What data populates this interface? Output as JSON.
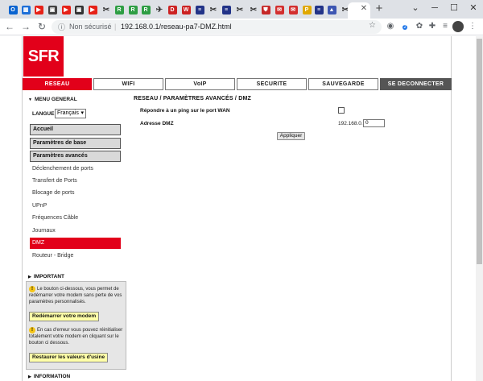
{
  "browser": {
    "tabs": [
      {
        "icon": "outlook",
        "color": "#0a64d0",
        "glyph": "O"
      },
      {
        "icon": "tab-generic",
        "color": "#1d6fd8",
        "glyph": "▦"
      },
      {
        "icon": "youtube",
        "color": "#e62117",
        "glyph": "▶"
      },
      {
        "icon": "tab-video",
        "color": "#444444",
        "glyph": "▣"
      },
      {
        "icon": "youtube",
        "color": "#e62117",
        "glyph": "▶"
      },
      {
        "icon": "tab-video",
        "color": "#333333",
        "glyph": "▣"
      },
      {
        "icon": "youtube",
        "color": "#e62117",
        "glyph": "▶"
      },
      {
        "icon": "tool",
        "color": "#555555",
        "glyph": "✂"
      },
      {
        "icon": "tab-green",
        "color": "#2e9e44",
        "glyph": "R"
      },
      {
        "icon": "tab-green",
        "color": "#2e9e44",
        "glyph": "R"
      },
      {
        "icon": "tab-green",
        "color": "#2e9e44",
        "glyph": "R"
      },
      {
        "icon": "tool",
        "color": "#555555",
        "glyph": "✈"
      },
      {
        "icon": "tab-red",
        "color": "#cc2222",
        "glyph": "D"
      },
      {
        "icon": "tab-red",
        "color": "#cc2222",
        "glyph": "W"
      },
      {
        "icon": "tab-blue",
        "color": "#223388",
        "glyph": "≡"
      },
      {
        "icon": "tool",
        "color": "#555555",
        "glyph": "✂"
      },
      {
        "icon": "tab-blue",
        "color": "#223388",
        "glyph": "≡"
      },
      {
        "icon": "tool",
        "color": "#555555",
        "glyph": "✂"
      },
      {
        "icon": "tool",
        "color": "#555555",
        "glyph": "✂"
      },
      {
        "icon": "shield",
        "color": "#c62828",
        "glyph": "⛊"
      },
      {
        "icon": "tab-red",
        "color": "#d32f2f",
        "glyph": "✉"
      },
      {
        "icon": "tab-red",
        "color": "#d32f2f",
        "glyph": "✉"
      },
      {
        "icon": "tab-yellow",
        "color": "#e0a800",
        "glyph": "P"
      },
      {
        "icon": "tab-blue",
        "color": "#223388",
        "glyph": "≡"
      },
      {
        "icon": "tab-photo",
        "color": "#3d56b2",
        "glyph": "▲"
      },
      {
        "icon": "tool",
        "color": "#555555",
        "glyph": "✂"
      },
      {
        "icon": "tab-blue",
        "color": "#223388",
        "glyph": "≡"
      }
    ],
    "address": {
      "status": "Non sécurisé",
      "separator": "|",
      "url": "192.168.0.1/reseau-pa7-DMZ.html"
    },
    "extension_badge": "2"
  },
  "page": {
    "logo": "SFR",
    "nav": [
      "RESEAU",
      "WIFI",
      "VoIP",
      "SECURITE",
      "SAUVEGARDE",
      "SE DECONNECTER"
    ],
    "sidebar": {
      "menu_general": "MENU GENERAL",
      "langue_label": "LANGUE",
      "langue_value": "Français",
      "sections": [
        "Accueil",
        "Paramètres de base",
        "Paramètres avancés"
      ],
      "items": [
        "Déclenchement de ports",
        "Transfert de Ports",
        "Blocage de ports",
        "UPnP",
        "Fréquences Câble",
        "Journaux",
        "DMZ",
        "Routeur - Bridge"
      ],
      "active_item": "DMZ",
      "important_title": "IMPORTANT",
      "note1": "Le bouton ci-dessous, vous permet de redémarrer votre modem sans perte de vos paramètres personnalisés.",
      "restart_label": "Redémarrer votre modem",
      "note2": "En cas d'erreur vous pouvez réinitialiser totalement votre modem en cliquant sur le bouton ci dessous.",
      "restore_label": "Restaurer les valeurs d'usine",
      "information_title": "INFORMATION"
    },
    "content": {
      "title": "RESEAU / PARAMÈTRES AVANCÉS / DMZ",
      "ping_label": "Répondre à un ping sur le port WAN",
      "ping_checked": false,
      "dmz_label": "Adresse DMZ",
      "ip_prefix": "192.168.0.",
      "ip_value": "0",
      "apply_label": "Appliquer"
    }
  }
}
